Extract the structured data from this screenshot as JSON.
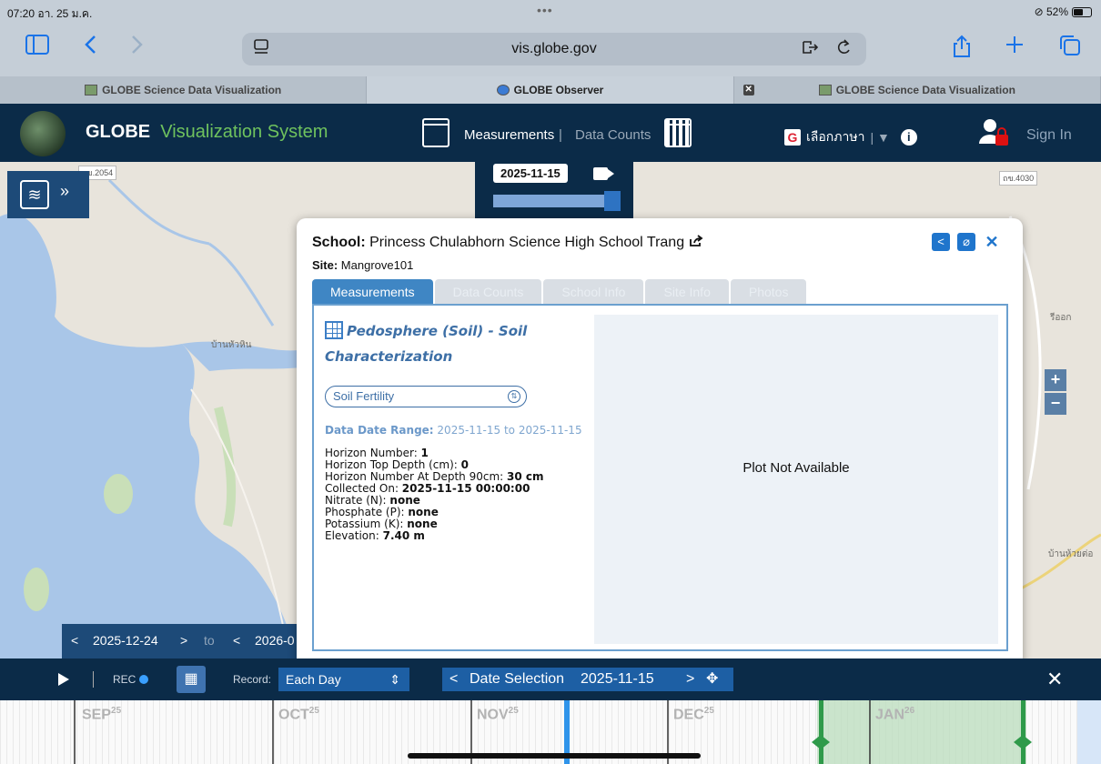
{
  "status_bar": {
    "time": "07:20",
    "date": "อา. 25 ม.ค.",
    "dots": "•••",
    "battery": "⊘ 52%"
  },
  "browser": {
    "url": "vis.globe.gov",
    "tabs": [
      {
        "label": "GLOBE Science Data Visualization",
        "active": false
      },
      {
        "label": "GLOBE Observer",
        "active": true
      },
      {
        "label": "GLOBE Science Data Visualization",
        "active": false
      }
    ]
  },
  "header": {
    "brand": "GLOBE",
    "brand_sub": "Visualization System",
    "measurements": "Measurements",
    "data_counts": "Data Counts",
    "language": "เลือกภาษา",
    "language_sep": "| ▼",
    "sign_in": "Sign In"
  },
  "map": {
    "current_date": "2025-11-15",
    "road_labels": [
      "ถข.2054",
      "ถข.4030"
    ],
    "place_labels": [
      "บ้านหัวหิน",
      "บ้านห้วยต่อ",
      "รีออก"
    ],
    "range_start": "2025-12-24",
    "range_to": "to",
    "range_end": "2026-0"
  },
  "popup": {
    "school_label": "School:",
    "school_name": "Princess Chulabhorn Science High School Trang",
    "site_label": "Site:",
    "site_name": "Mangrove101",
    "tabs": [
      "Measurements",
      "Data Counts",
      "School Info",
      "Site Info",
      "Photos"
    ],
    "protocol_title_1": "Pedosphere (Soil) - Soil",
    "protocol_title_2": "Characterization",
    "select_value": "Soil Fertility",
    "date_range_label": "Data Date Range:",
    "date_range_value": "2025-11-15 to 2025-11-15",
    "details": [
      {
        "label": "Horizon Number: ",
        "value": "1"
      },
      {
        "label": "Horizon Top Depth (cm): ",
        "value": "0"
      },
      {
        "label": "Horizon Number At Depth 90cm: ",
        "value": "30 cm"
      },
      {
        "label": "Collected On: ",
        "value": "2025-11-15 00:00:00"
      },
      {
        "label": "Nitrate (N): ",
        "value": "none"
      },
      {
        "label": "Phosphate (P): ",
        "value": "none"
      },
      {
        "label": "Potassium (K): ",
        "value": "none"
      },
      {
        "label": "Elevation: ",
        "value": "7.40 m"
      }
    ],
    "plot_message": "Plot Not Available"
  },
  "controls": {
    "rec": "REC",
    "record_label": "Record:",
    "record_value": "Each Day",
    "date_selection_label": "Date Selection",
    "date_selection_value": "2025-11-15",
    "close": "✕"
  },
  "timeline": {
    "months": [
      {
        "name": "SEP",
        "year": "25"
      },
      {
        "name": "OCT",
        "year": "25"
      },
      {
        "name": "NOV",
        "year": "25"
      },
      {
        "name": "DEC",
        "year": "25"
      },
      {
        "name": "JAN",
        "year": "26"
      }
    ]
  },
  "colors": {
    "header": "#0b2b48",
    "accent": "#3f86c4",
    "brand_green": "#6fc25e",
    "selection": "#2f94ea"
  }
}
